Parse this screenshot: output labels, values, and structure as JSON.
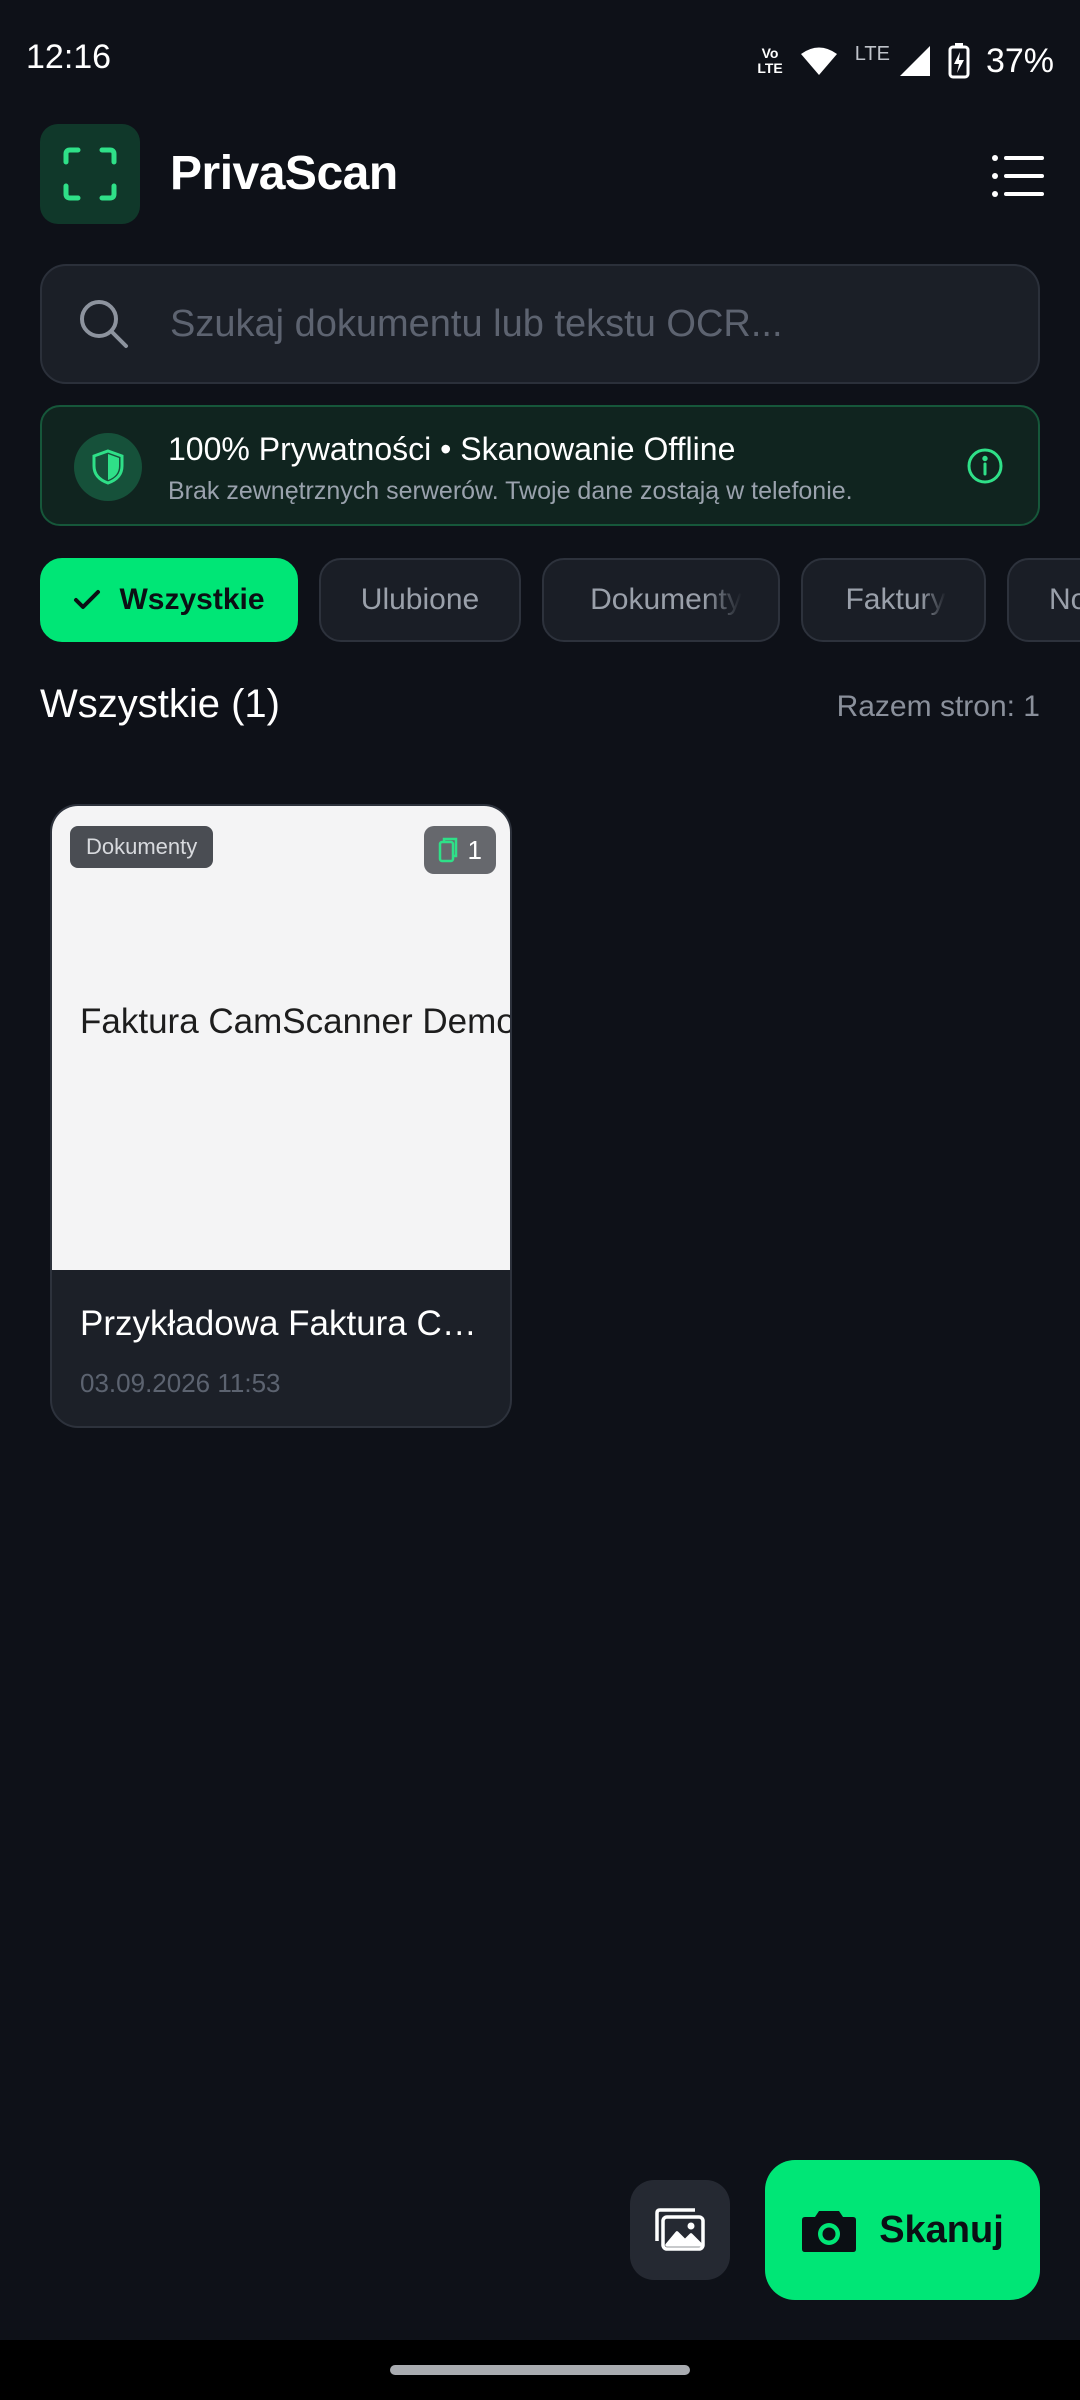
{
  "status_bar": {
    "time": "12:16",
    "volte_top": "Vo",
    "volte_bottom": "LTE",
    "lte": "LTE",
    "battery": "37%"
  },
  "header": {
    "title": "PrivaScan",
    "logo_icon": "scan-frame-icon",
    "menu_icon": "menu-list-icon"
  },
  "search": {
    "placeholder": "Szukaj dokumentu lub tekstu OCR..."
  },
  "privacy": {
    "title": "100% Prywatności • Skanowanie Offline",
    "subtitle": "Brak zewnętrznych serwerów. Twoje dane zostają w telefonie."
  },
  "filters": [
    {
      "label": "Wszystkie",
      "active": true
    },
    {
      "label": "Ulubione",
      "active": false
    },
    {
      "label": "Dokumenty",
      "active": false
    },
    {
      "label": "Faktury",
      "active": false
    },
    {
      "label": "No",
      "active": false
    }
  ],
  "section": {
    "title": "Wszystkie (1)",
    "page_total": "Razem stron: 1"
  },
  "documents": [
    {
      "category": "Dokumenty",
      "page_count": "1",
      "thumbnail_text": "Faktura CamScanner Demo",
      "title": "Przykładowa Faktura CamScanner Demo",
      "date": "03.09.2026 11:53"
    }
  ],
  "actions": {
    "scan_label": "Skanuj",
    "gallery_icon": "gallery-icon",
    "camera_icon": "camera-icon"
  },
  "colors": {
    "accent": "#00e676",
    "background": "#0e1118",
    "card": "#1c2028"
  }
}
